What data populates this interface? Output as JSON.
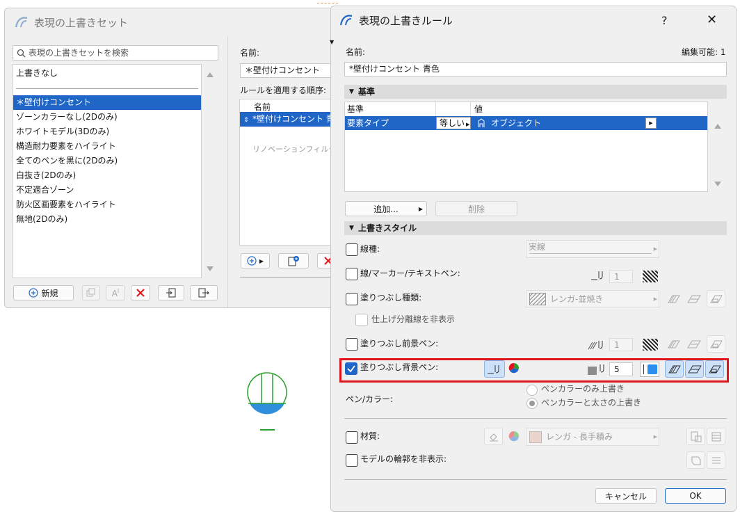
{
  "left_window": {
    "title": "表現の上書きセット",
    "search_placeholder": "表現の上書きセットを検索",
    "no_override": "上書きなし",
    "sets": [
      "＊壁付けコンセント",
      "ゾーンカラーなし(2Dのみ)",
      "ホワイトモデル(3Dのみ)",
      "構造耐力要素をハイライト",
      "全てのペンを黒に(2Dのみ)",
      "白抜き(2Dのみ)",
      "不定適合ゾーン",
      "防火区画要素をハイライト",
      "無地(2Dのみ)"
    ],
    "new_button": "新規",
    "name_label": "名前:",
    "name_value": "＊壁付けコンセント",
    "order_label": "ルールを適用する順序:",
    "rules_header": "名前",
    "rule_row": "*壁付けコンセント  青色",
    "renovation_text": "リノベーションフィルタによ"
  },
  "dialog": {
    "title": "表現の上書きルール",
    "help": "?",
    "close": "✕",
    "name_label": "名前:",
    "editable": "編集可能: 1",
    "name_value": "*壁付けコンセント  青色",
    "criteria": {
      "header": "基準",
      "col_criteria": "基準",
      "col_value": "値",
      "row_criteria": "要素タイプ",
      "row_operator": "等しい",
      "row_value": "オブジェクト",
      "add_button": "追加...",
      "delete_button": "削除"
    },
    "style": {
      "header": "上書きスタイル",
      "line_type": "線種:",
      "line_type_value": "実線",
      "line_pen": "線/マーカー/テキストペン:",
      "line_pen_value": "1",
      "fill_type": "塗りつぶし種類:",
      "fill_type_value": "レンガ-並焼き",
      "hide_sep": "仕上げ分離線を非表示",
      "fill_fg": "塗りつぶし前景ペン:",
      "fill_fg_value": "1",
      "fill_bg": "塗りつぶし背景ペン:",
      "fill_bg_value": "5",
      "pen_color": "ペン/カラー:",
      "radio1": "ペンカラーのみ上書き",
      "radio2": "ペンカラーと太さの上書き",
      "material": "材質:",
      "material_value": "レンガ - 長手積み",
      "hide_contour": "モデルの輪郭を非表示:"
    },
    "cancel": "キャンセル",
    "ok": "OK"
  },
  "colors": {
    "accent": "#1f66c7",
    "highlight_border": "#e0141b",
    "pen5_swatch": "#2b8ff0"
  }
}
